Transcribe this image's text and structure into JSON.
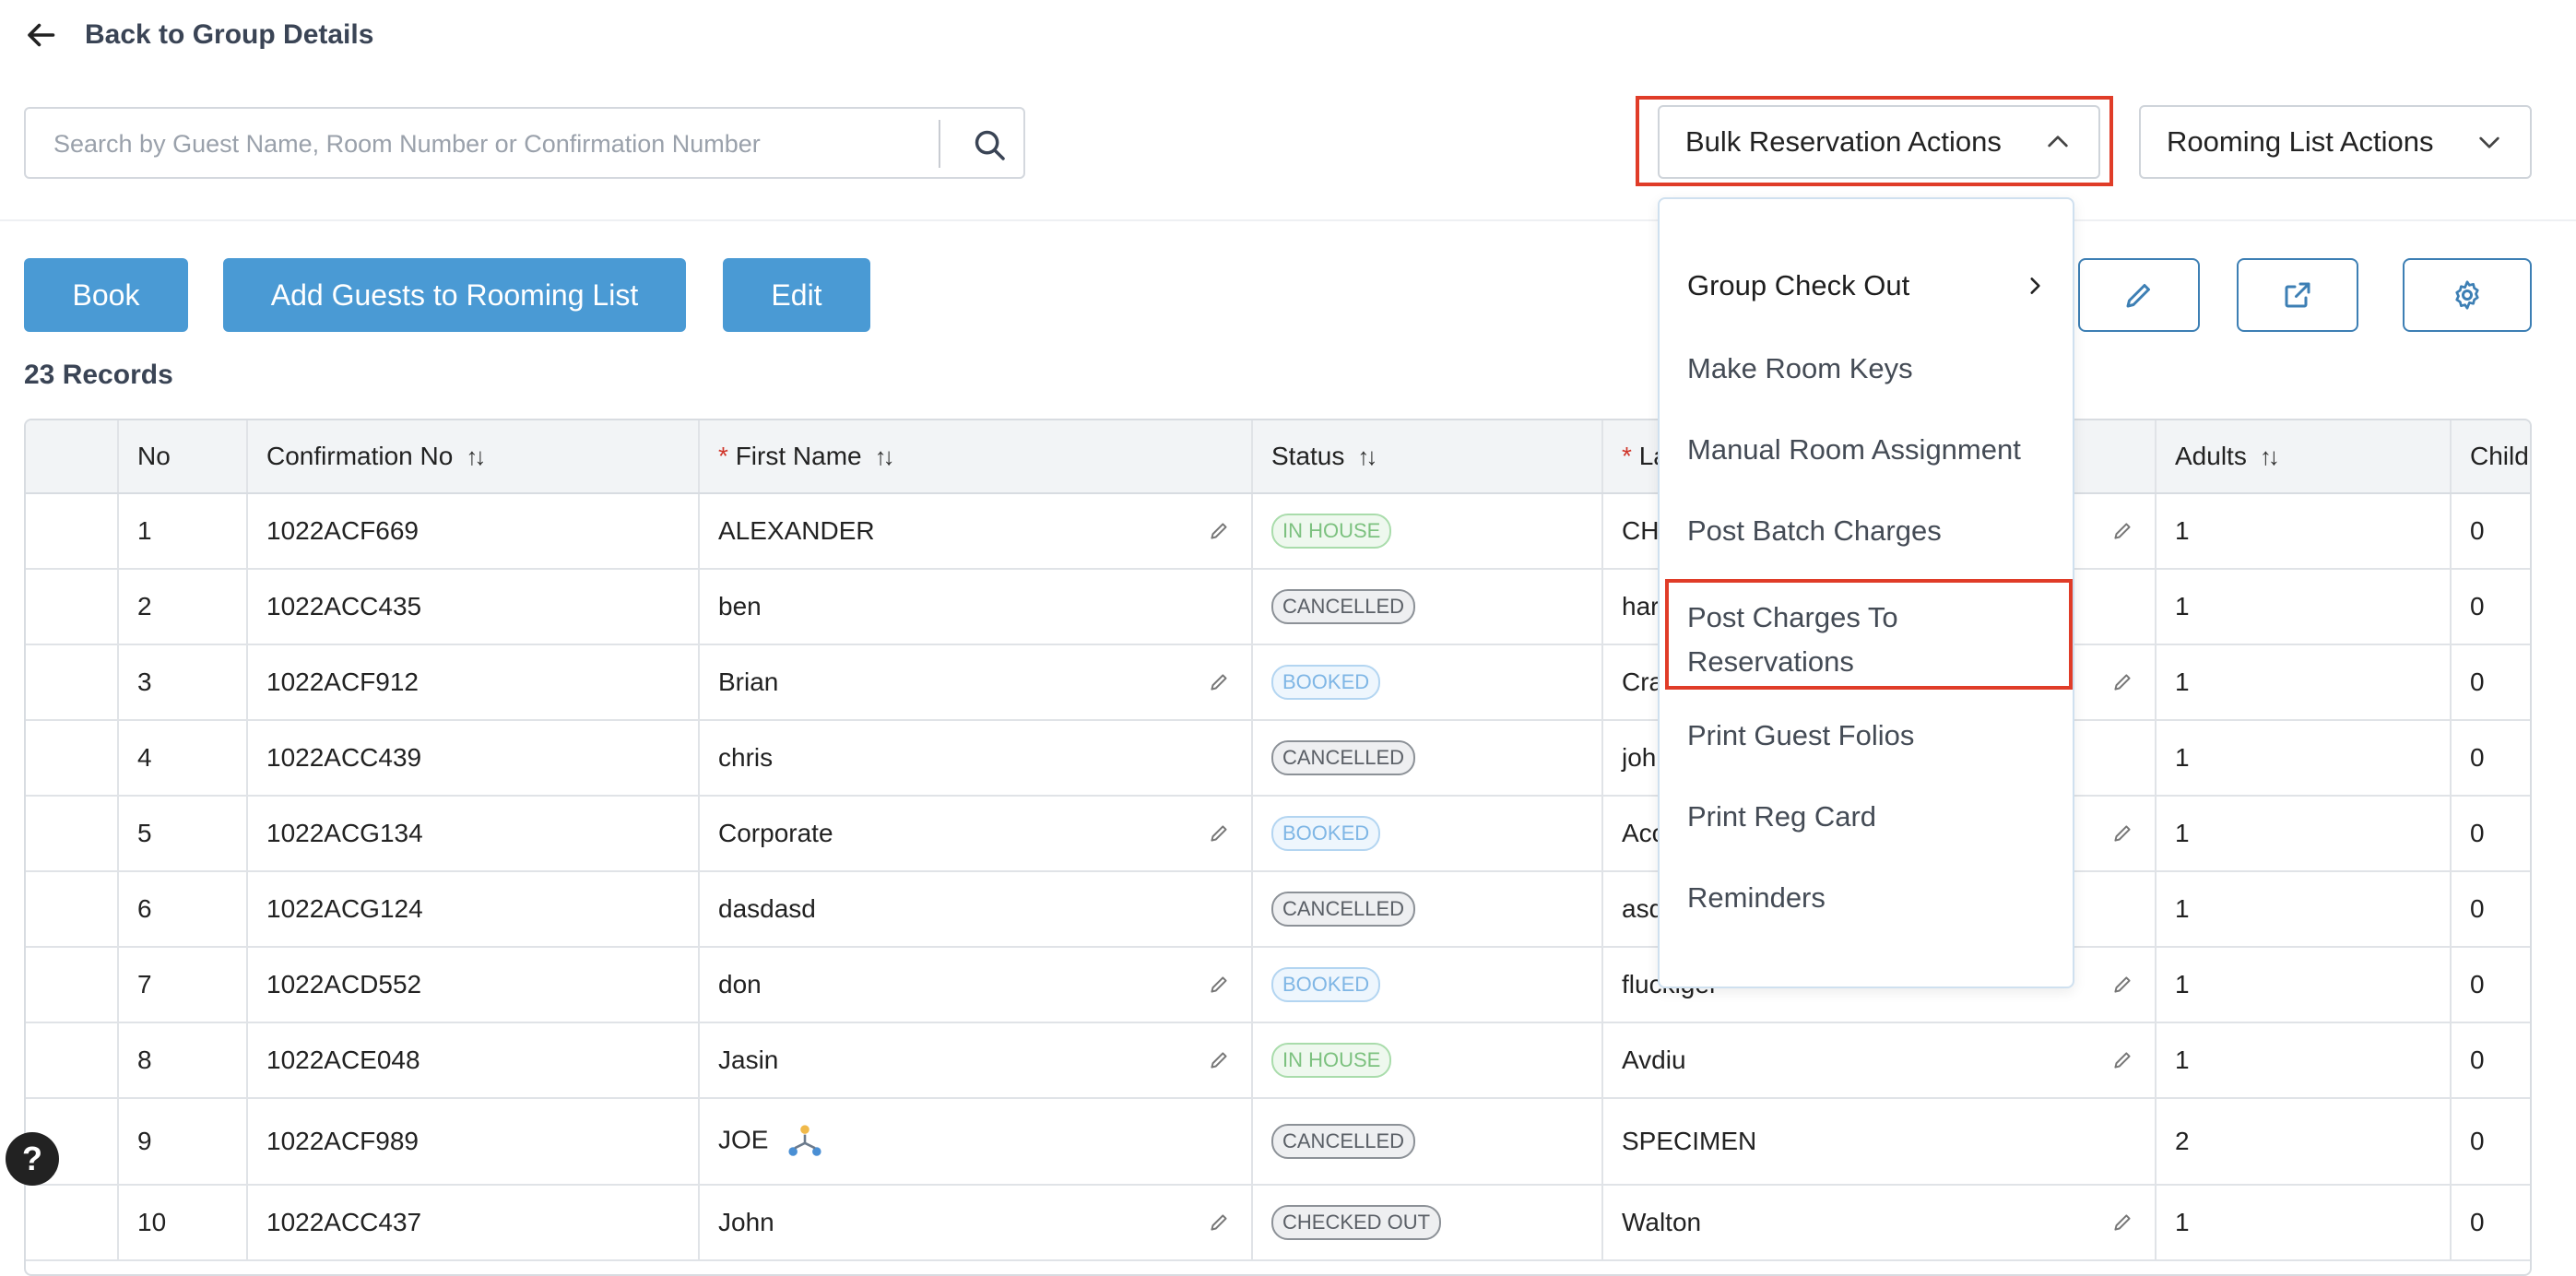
{
  "back_link": "Back to Group Details",
  "search": {
    "placeholder": "Search by Guest Name, Room Number or Confirmation Number",
    "value": ""
  },
  "bulk_actions_label": "Bulk Reservation Actions",
  "rooming_actions_label": "Rooming List Actions",
  "buttons": {
    "book": "Book",
    "add_guests": "Add Guests to Rooming List",
    "edit": "Edit"
  },
  "records": "23 Records",
  "columns": {
    "no": "No",
    "conf": "Confirmation No",
    "first": "First Name",
    "status": "Status",
    "last": "La",
    "adults": "Adults",
    "child": "Child"
  },
  "rows": [
    {
      "no": "1",
      "conf": "1022ACF669",
      "first": "ALEXANDER",
      "status": "IN HOUSE",
      "last": "CH",
      "adults": "1",
      "child": "0"
    },
    {
      "no": "2",
      "conf": "1022ACC435",
      "first": "ben",
      "status": "CANCELLED",
      "last": "har",
      "adults": "1",
      "child": "0"
    },
    {
      "no": "3",
      "conf": "1022ACF912",
      "first": "Brian",
      "status": "BOOKED",
      "last": "Cra",
      "adults": "1",
      "child": "0"
    },
    {
      "no": "4",
      "conf": "1022ACC439",
      "first": "chris",
      "status": "CANCELLED",
      "last": "joh",
      "adults": "1",
      "child": "0"
    },
    {
      "no": "5",
      "conf": "1022ACG134",
      "first": "Corporate",
      "status": "BOOKED",
      "last": "Acc",
      "adults": "1",
      "child": "0"
    },
    {
      "no": "6",
      "conf": "1022ACG124",
      "first": "dasdasd",
      "status": "CANCELLED",
      "last": "asd",
      "adults": "1",
      "child": "0"
    },
    {
      "no": "7",
      "conf": "1022ACD552",
      "first": "don",
      "status": "BOOKED",
      "last": "fluckiger",
      "adults": "1",
      "child": "0"
    },
    {
      "no": "8",
      "conf": "1022ACE048",
      "first": "Jasin",
      "status": "IN HOUSE",
      "last": "Avdiu",
      "adults": "1",
      "child": "0"
    },
    {
      "no": "9",
      "conf": "1022ACF989",
      "first": "JOE",
      "status": "CANCELLED",
      "last": "SPECIMEN",
      "adults": "2",
      "child": "0"
    },
    {
      "no": "10",
      "conf": "1022ACC437",
      "first": "John",
      "status": "CHECKED OUT",
      "last": "Walton",
      "adults": "1",
      "child": "0"
    }
  ],
  "menu_items": {
    "group_check_out": "Group Check Out",
    "make_room_keys": "Make Room Keys",
    "manual_room_assignment": "Manual Room Assignment",
    "post_batch_charges": "Post Batch Charges",
    "post_charges_line1": "Post Charges To",
    "post_charges_line2": "Reservations",
    "print_guest_folios": "Print Guest Folios",
    "print_reg_card": "Print Reg Card",
    "reminders": "Reminders"
  },
  "help_glyph": "?",
  "colors": {
    "primary": "#4a9ad4",
    "highlight": "#e03c28"
  }
}
